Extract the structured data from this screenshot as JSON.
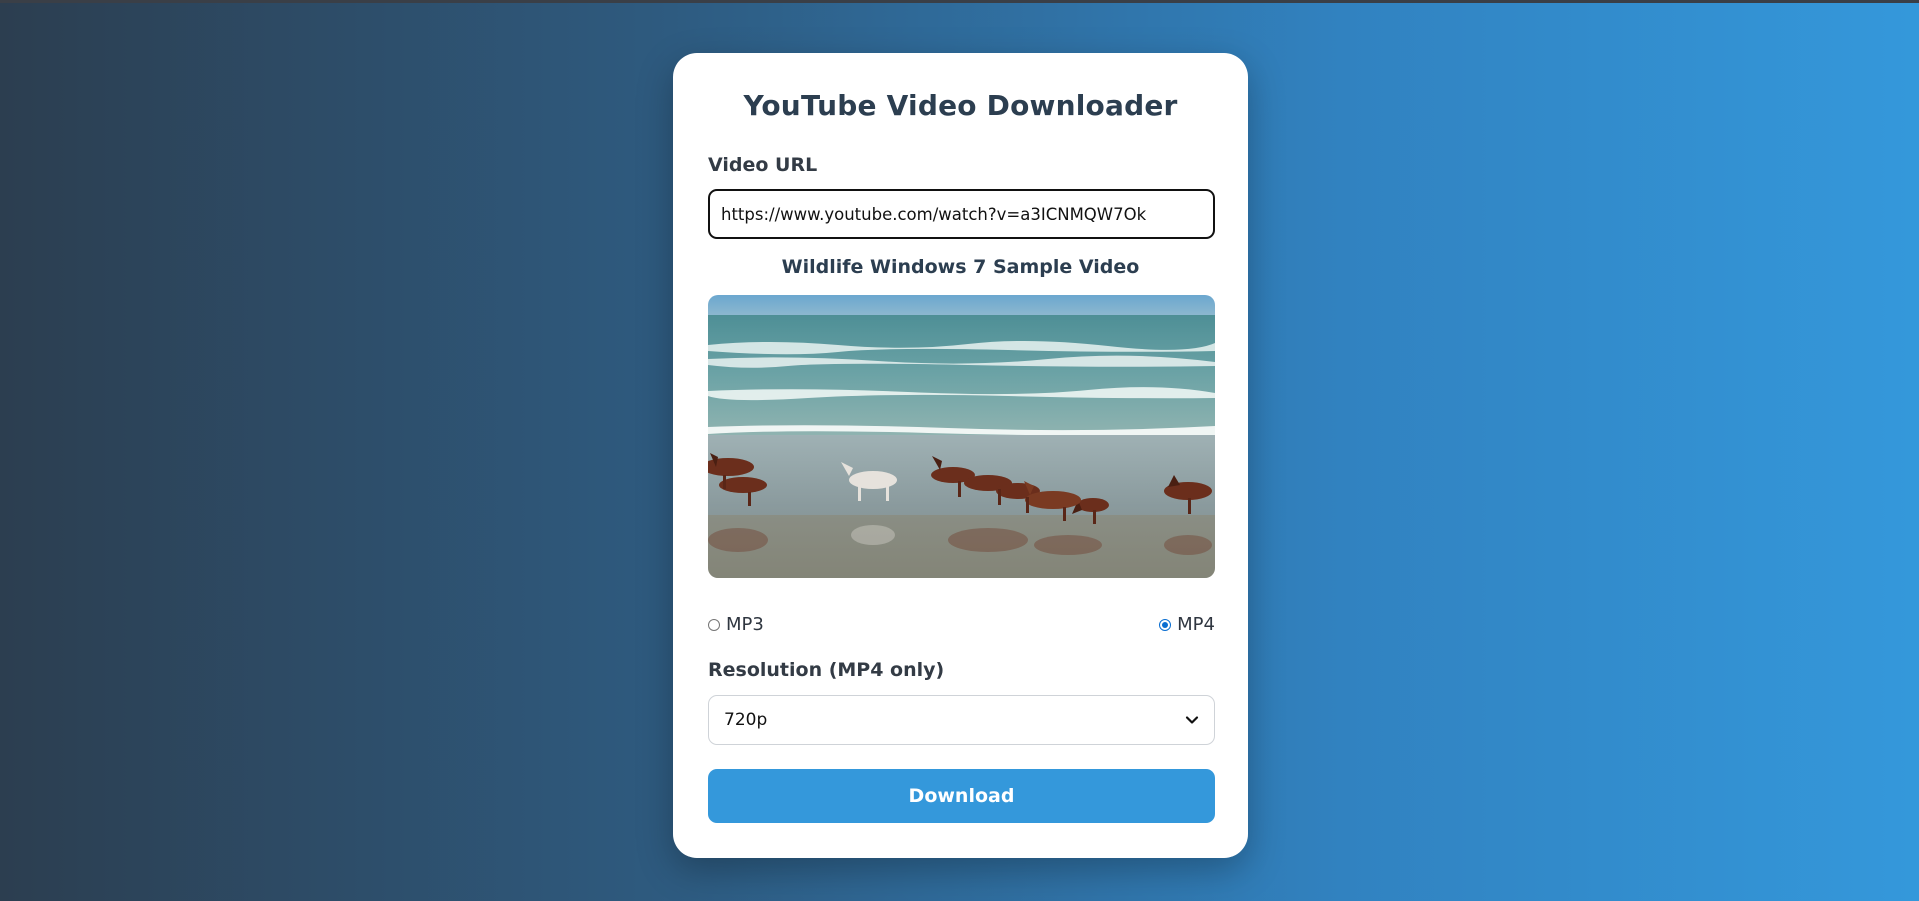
{
  "header": {
    "title": "YouTube Video Downloader"
  },
  "form": {
    "url_label": "Video URL",
    "url_value": "https://www.youtube.com/watch?v=a3ICNMQW7Ok",
    "video_title": "Wildlife Windows 7 Sample Video",
    "formats": [
      {
        "label": "MP3",
        "checked": false
      },
      {
        "label": "MP4",
        "checked": true
      }
    ],
    "resolution_label": "Resolution (MP4 only)",
    "resolution_value": "720p",
    "download_label": "Download"
  },
  "colors": {
    "accent": "#3498db",
    "title_text": "#2c3e50",
    "gradient_start": "#2c3e50",
    "gradient_end": "#3498db"
  },
  "icons": {
    "select_arrow": "chevron-down-icon"
  }
}
